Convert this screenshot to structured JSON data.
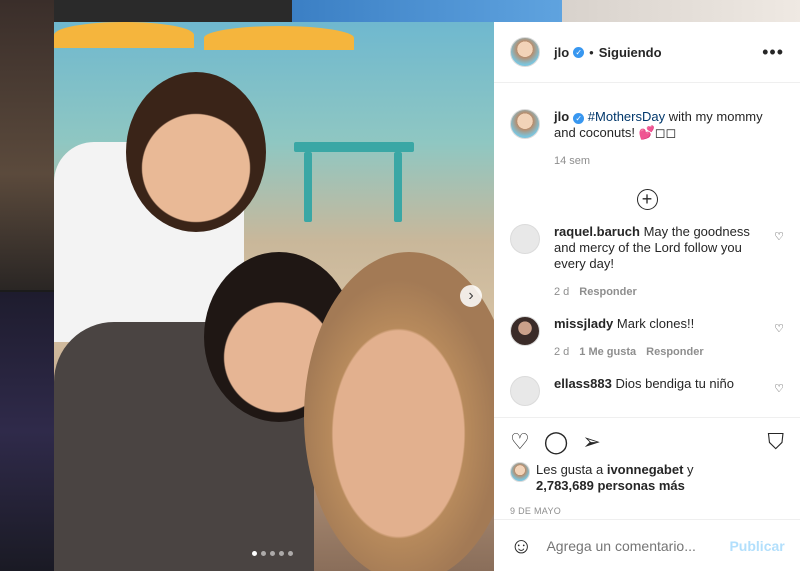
{
  "post": {
    "username": "jlo",
    "follow_status": "Siguiendo",
    "separator": "•",
    "more_icon": "•••"
  },
  "caption": {
    "username": "jlo",
    "hashtag": "#MothersDay",
    "text": " with my mommy and coconuts! 💕◻◻",
    "time": "14 sem"
  },
  "comments": [
    {
      "username": "raquel.baruch",
      "text": "May the goodness and mercy of the Lord follow you every day!",
      "time": "2 d",
      "likes": "",
      "reply": "Responder"
    },
    {
      "username": "missjlady",
      "text": "Mark clones!!",
      "time": "2 d",
      "likes": "1 Me gusta",
      "reply": "Responder"
    },
    {
      "username": "ellass883",
      "text": "Dios bendiga tu niño",
      "time": "",
      "likes": "",
      "reply": ""
    }
  ],
  "likes": {
    "prefix": "Les gusta a ",
    "user": "ivonnegabet",
    "connector": " y",
    "others": "2,783,689 personas más"
  },
  "date": "9 DE MAYO",
  "add_comment": {
    "placeholder": "Agrega un comentario...",
    "post_label": "Publicar"
  },
  "carousel": {
    "current": 1,
    "total": 5
  }
}
